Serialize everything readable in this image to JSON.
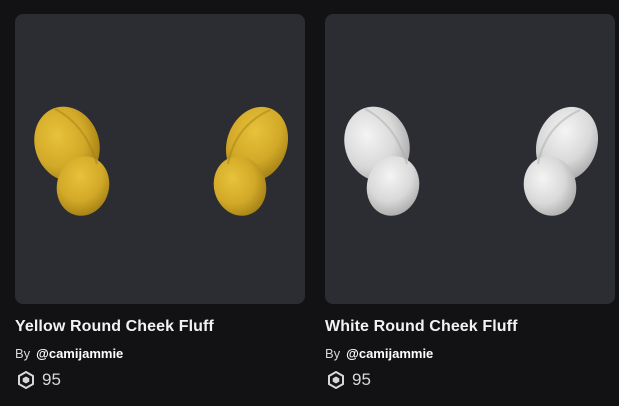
{
  "items": [
    {
      "name": "Yellow Round Cheek Fluff",
      "by_label": "By",
      "creator": "@camijammie",
      "price": "95",
      "currency_icon": "robux-icon",
      "color_light": "#e7c23a",
      "color_mid": "#d2a928",
      "color_dark": "#a37f15"
    },
    {
      "name": "White Round Cheek Fluff",
      "by_label": "By",
      "creator": "@camijammie",
      "price": "95",
      "currency_icon": "robux-icon",
      "color_light": "#f4f4f4",
      "color_mid": "#d9d9d9",
      "color_dark": "#a9a9a9"
    }
  ]
}
